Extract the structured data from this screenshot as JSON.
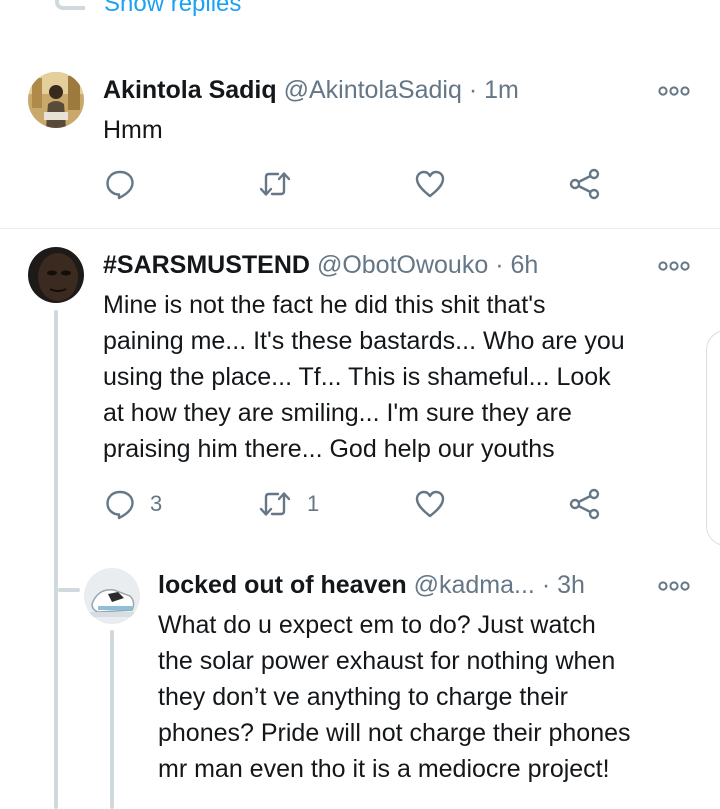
{
  "thread": {
    "show_replies": "Show replies"
  },
  "tweets": [
    {
      "name": "Akintola Sadiq",
      "handle": "@AkintolaSadiq",
      "sep": "·",
      "time": "1m",
      "text": "Hmm",
      "actions": {
        "reply_count": "",
        "retweet_count": ""
      }
    },
    {
      "name": "#SARSMUSTEND",
      "handle": "@ObotOwouko",
      "sep": "·",
      "time": "6h",
      "lines": [
        "Mine is not the fact he did this shit that's",
        "paining me... It's these bastards... Who are you",
        "using the place... Tf... This is shameful... Look",
        "at how they are smiling... I'm sure they are",
        "praising him there... God help our youths"
      ],
      "actions": {
        "reply_count": "3",
        "retweet_count": "1"
      }
    },
    {
      "name": "locked out of heaven",
      "handle": "@kadma...",
      "sep": "·",
      "time": "3h",
      "lines": [
        "What do u expect em to do? Just watch",
        "the solar power exhaust for nothing when",
        "they don’t ve anything to charge their",
        "phones? Pride will not charge their phones",
        "mr man even tho it is a mediocre project!"
      ]
    }
  ],
  "icons": {
    "reply": "reply-icon",
    "retweet": "retweet-icon",
    "like": "heart-icon",
    "share": "share-icon",
    "more": "more-options-icon"
  },
  "colors": {
    "link": "#1da1f2",
    "text": "#14171a",
    "secondary": "#657786",
    "thread_line": "#cfd9de"
  }
}
